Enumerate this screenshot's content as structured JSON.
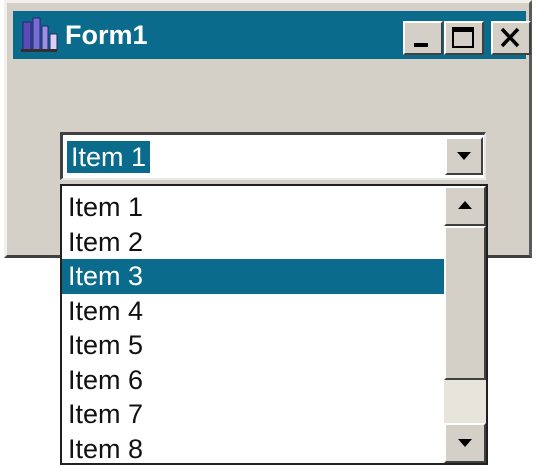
{
  "window": {
    "title": "Form1",
    "title_bar_color": "#0a6b8c",
    "background_color": "#d4d0c8"
  },
  "title_buttons": {
    "minimize_icon": "minimize-icon",
    "maximize_icon": "maximize-icon",
    "close_icon": "close-icon"
  },
  "combo": {
    "value": "Item 1",
    "arrow_icon": "chevron-down-icon"
  },
  "dropdown": {
    "items": [
      "Item 1",
      "Item 2",
      "Item 3",
      "Item 4",
      "Item 5",
      "Item 6",
      "Item 7",
      "Item 8"
    ],
    "selected_item": "Item 3",
    "selection_color": "#0a6b8c"
  },
  "scrollbar": {
    "up_icon": "arrow-up-icon",
    "down_icon": "arrow-down-icon"
  }
}
